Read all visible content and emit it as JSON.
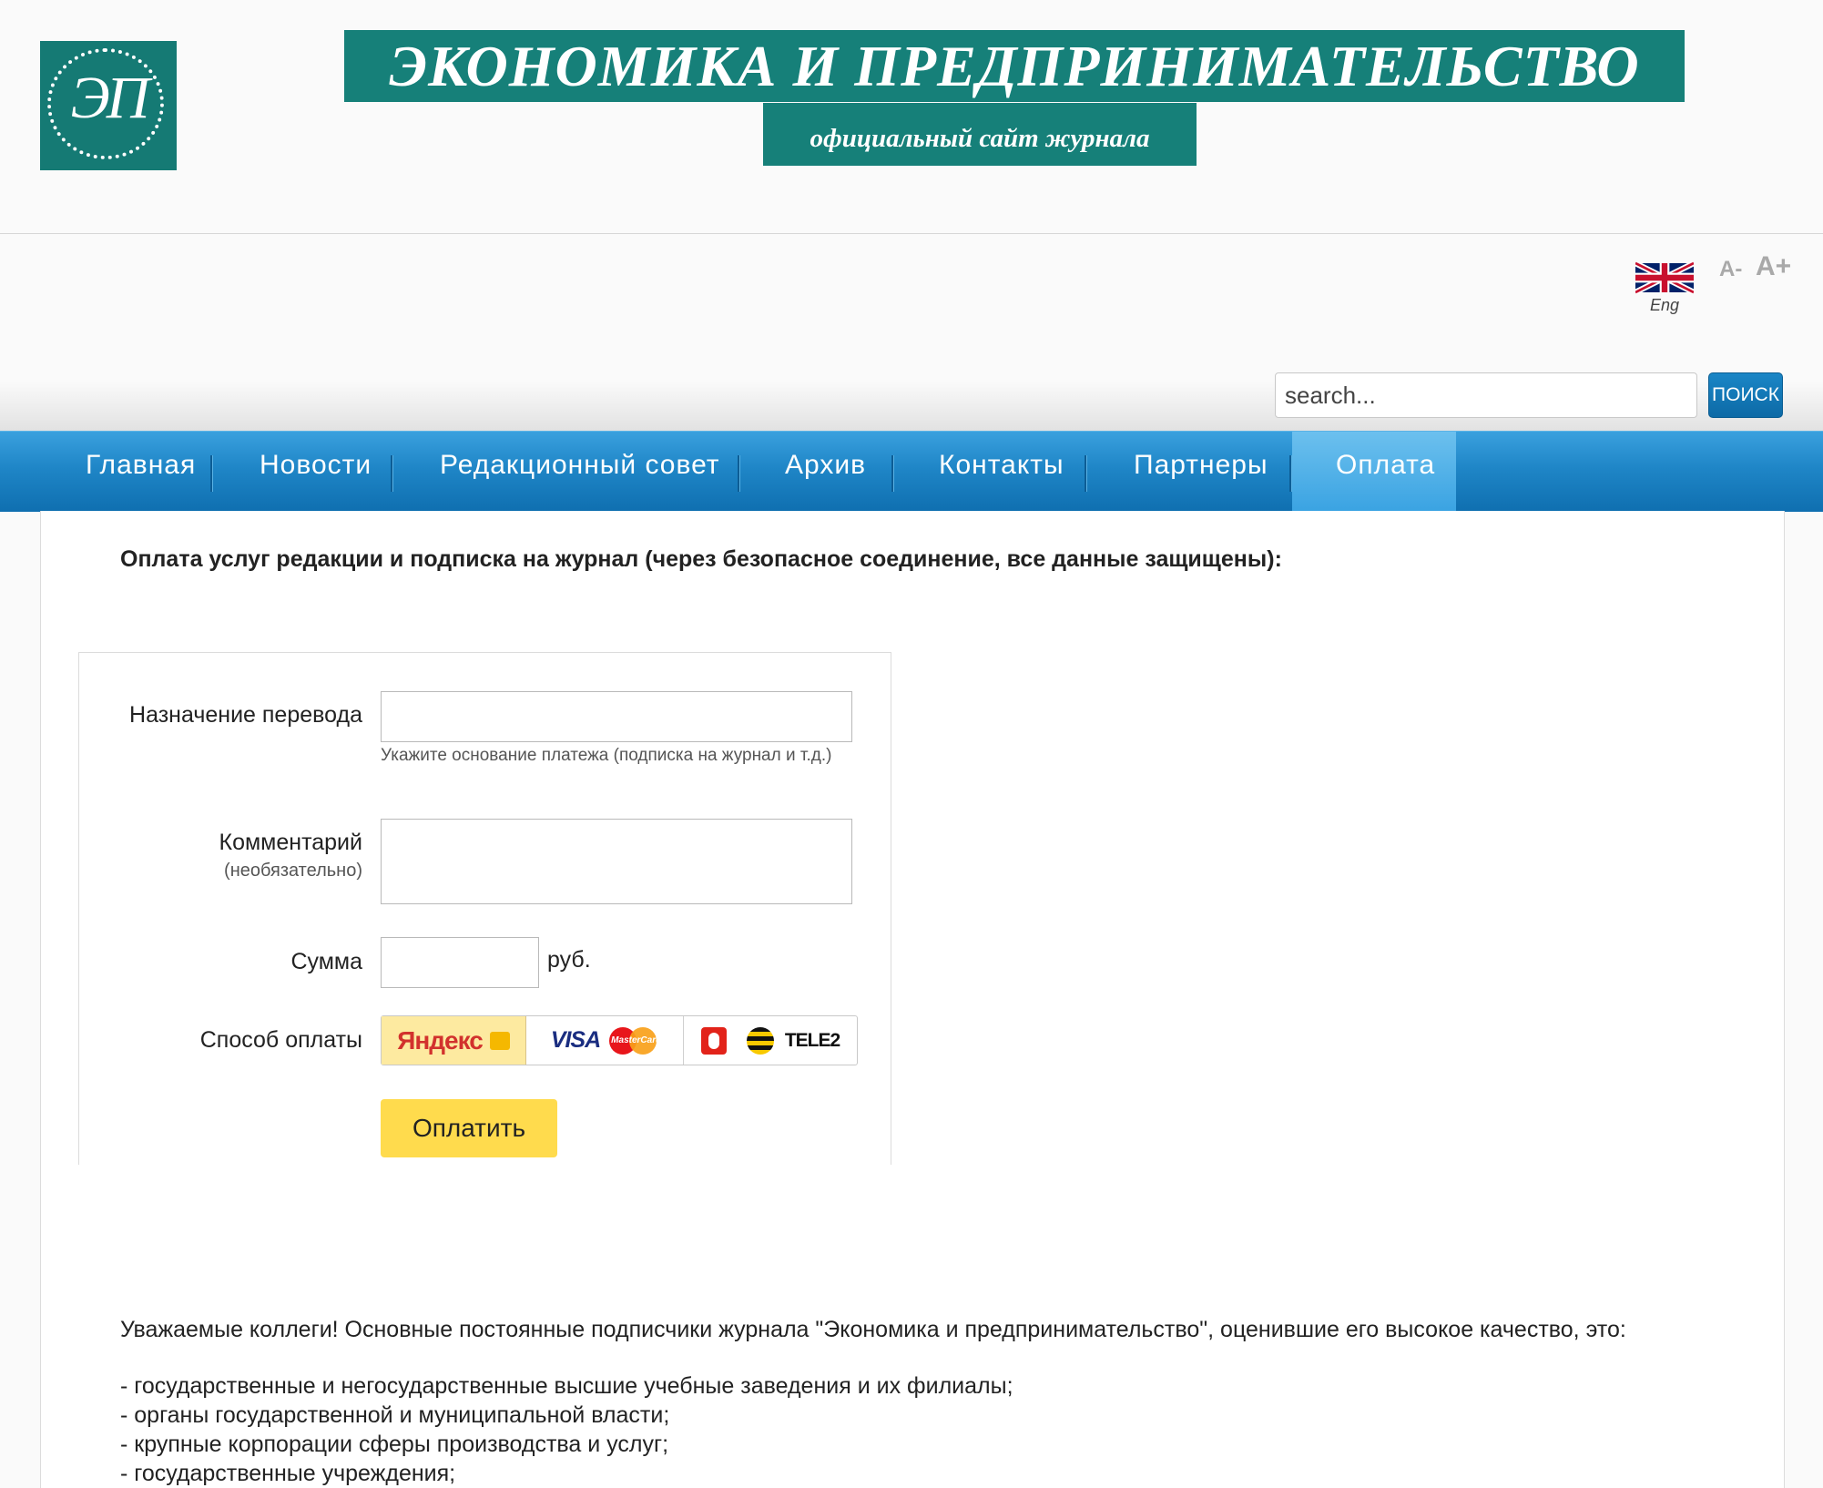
{
  "header": {
    "logo_text": "ЭП",
    "title": "ЭКОНОМИКА И ПРЕДПРИНИМАТЕЛЬСТВО",
    "subtitle": "официальный сайт журнала"
  },
  "toolbar": {
    "lang_label": "Eng",
    "font_decrease": "A-",
    "font_increase": "A+",
    "search_placeholder": "search...",
    "search_button": "ПОИСК"
  },
  "nav": {
    "items": [
      {
        "label": "Главная"
      },
      {
        "label": "Новости"
      },
      {
        "label": "Редакционный совет"
      },
      {
        "label": "Архив"
      },
      {
        "label": "Контакты"
      },
      {
        "label": "Партнеры"
      },
      {
        "label": "Оплата",
        "active": true
      }
    ]
  },
  "content": {
    "heading": "Оплата услуг редакции и подписка на журнал (через безопасное соединение, все данные защищены):",
    "form": {
      "purpose_label": "Назначение перевода",
      "purpose_value": "",
      "purpose_hint": "Укажите основание платежа (подписка на журнал и т.д.)",
      "comment_label": "Комментарий",
      "comment_sublabel": "(необязательно)",
      "comment_value": "",
      "amount_label": "Сумма",
      "amount_value": "",
      "amount_unit": "руб.",
      "method_label": "Способ оплаты",
      "methods": {
        "yandex": "Яндекс",
        "card_visa": "VISA",
        "card_mastercard": "MasterCard",
        "mobile_tele2": "TELE2"
      },
      "selected_method": "yandex",
      "submit_label": "Оплатить"
    },
    "intro": "Уважаемые коллеги! Основные постоянные подписчики журнала \"Экономика и предпринимательство\",  оценившие его высокое качество, это:",
    "list": [
      "- государственные и негосударственные высшие учебные заведения и их филиалы;",
      "- органы государственной и муниципальной власти;",
      "- крупные корпорации сферы производства и услуг;",
      "- государственные учреждения;"
    ]
  },
  "colors": {
    "brand_teal": "#168079",
    "nav_blue": "#1f86c7",
    "nav_active": "#5ab8ec",
    "search_button": "#1a7fbf",
    "pay_button": "#ffdb4d",
    "yandex_selected": "#fdeaa0"
  }
}
